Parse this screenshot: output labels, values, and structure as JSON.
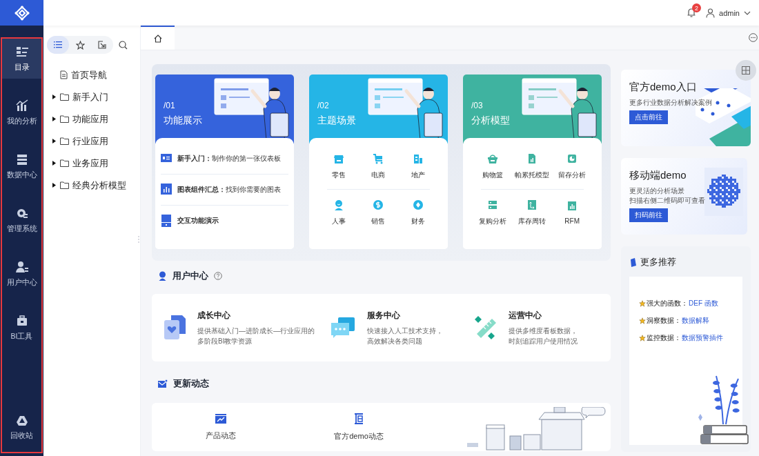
{
  "rail": {
    "highlighted": true,
    "items": [
      {
        "label": "目录",
        "selected": true
      },
      {
        "label": "我的分析",
        "selected": false
      },
      {
        "label": "数据中心",
        "selected": false
      },
      {
        "label": "管理系统",
        "selected": false
      },
      {
        "label": "用户中心",
        "selected": false
      },
      {
        "label": "BI工具",
        "selected": false
      }
    ],
    "bottom_item": {
      "label": "回收站"
    }
  },
  "header": {
    "notification_count": "2",
    "user": "admin"
  },
  "tree_panel": {
    "tabs": [
      {
        "kind": "list",
        "selected": true
      },
      {
        "kind": "favorite",
        "selected": false
      },
      {
        "kind": "export",
        "selected": false
      }
    ],
    "items": [
      {
        "kind": "page",
        "label": "首页导航"
      },
      {
        "kind": "folder",
        "label": "新手入门",
        "expanded": false
      },
      {
        "kind": "folder",
        "label": "功能应用",
        "expanded": false
      },
      {
        "kind": "folder",
        "label": "行业应用",
        "expanded": false
      },
      {
        "kind": "folder",
        "label": "业务应用",
        "expanded": false
      },
      {
        "kind": "folder",
        "label": "经典分析模型",
        "expanded": false
      }
    ]
  },
  "tabs": [
    {
      "kind": "home",
      "selected": true
    }
  ],
  "cards": [
    {
      "kind": "list",
      "number": "/01",
      "title": "功能展示",
      "color": "#3563dc",
      "items": [
        "**新手入门：**制作你的第一张仪表板",
        "**图表组件汇总：**找到你需要的图表",
        "**交互功能演示**"
      ]
    },
    {
      "kind": "grid",
      "number": "/02",
      "title": "主题场景",
      "color": "#25b5e6",
      "items": [
        "零售",
        "电商",
        "地产",
        "人事",
        "销售",
        "财务"
      ]
    },
    {
      "kind": "grid",
      "number": "/03",
      "title": "分析模型",
      "color": "#3fb3a0",
      "items": [
        "购物篮",
        "帕累托模型",
        "留存分析",
        "复购分析",
        "库存周转",
        "RFM"
      ]
    }
  ],
  "user_center": {
    "title": "用户中心",
    "items": [
      {
        "title": "成长中心",
        "description": [
          "提供基础入门—进阶成长—行业应用的",
          "多阶段BI教学资源"
        ]
      },
      {
        "title": "服务中心",
        "description": [
          "快速接入人工技术支持，",
          "高效解决各类问题"
        ]
      },
      {
        "title": "运营中心",
        "description": [
          "提供多维度看板数据，",
          "时刻追踪用户使用情况"
        ]
      }
    ]
  },
  "updates": {
    "title": "更新动态",
    "items": [
      {
        "label": "产品动态"
      },
      {
        "label": "官方demo动态"
      }
    ]
  },
  "promos": [
    {
      "kind": "collage",
      "title": "官方demo入口",
      "lines": [
        "更多行业数据分析解决案例"
      ],
      "button": "点击前往"
    },
    {
      "kind": "qr",
      "title": "移动端demo",
      "lines": [
        "更灵活的分析场景",
        "扫描右侧二维码即可查看"
      ],
      "button": "扫码前往"
    }
  ],
  "recommend": {
    "title": "更多推荐",
    "items": [
      {
        "label": "强大的函数：",
        "link": "DEF 函数"
      },
      {
        "label": "洞察数据：",
        "link": "数据解释"
      },
      {
        "label": "监控数据：",
        "link": "数据预警插件"
      }
    ]
  }
}
